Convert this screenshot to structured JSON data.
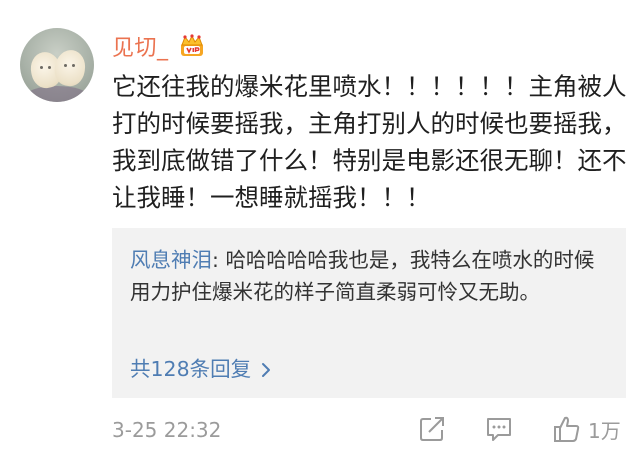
{
  "comment": {
    "username": "见切_",
    "text": "它还往我的爆米花里喷水！！！！！！主角被人打的时候要摇我，主角打别人的时候也要摇我，我到底做错了什么！特别是电影还很无聊！还不让我睡！一想睡就摇我！！！",
    "timestamp": "3-25 22:32",
    "like_count": "1万"
  },
  "reply": {
    "author": "风息神泪",
    "separator": ": ",
    "text": "哈哈哈哈哈我也是，我特么在喷水的时候用力护住爆米花的样子简直柔弱可怜又无助。",
    "more_label": "共128条回复"
  },
  "icons": {
    "badge": "vip-crown-icon",
    "share": "share-icon",
    "comment": "comment-icon",
    "like": "thumbs-up-icon",
    "more": "chevron-right-icon"
  },
  "colors": {
    "username": "#eb7350",
    "link": "#4f7db3",
    "muted": "#9b9b9b",
    "reply_background": "#f2f2f2"
  }
}
